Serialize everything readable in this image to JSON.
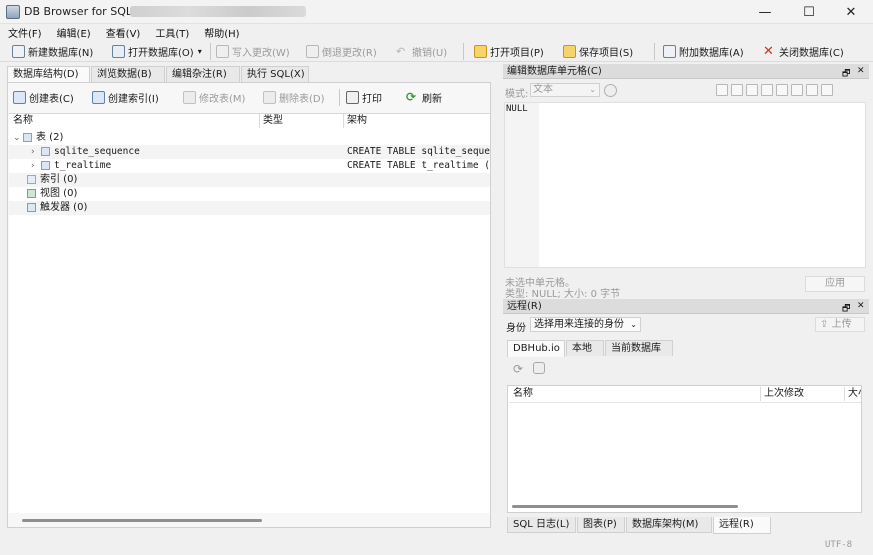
{
  "window": {
    "title": "DB Browser for SQLite - ",
    "controls": {
      "minimize": "—",
      "maximize": "☐",
      "close": "✕"
    }
  },
  "menubar": [
    "文件(F)",
    "编辑(E)",
    "查看(V)",
    "工具(T)",
    "帮助(H)"
  ],
  "toolbar": {
    "new_db": "新建数据库(N)",
    "open_db": "打开数据库(O)",
    "write_changes": "写入更改(W)",
    "revert_changes": "倒退更改(R)",
    "undo": "撤销(U)",
    "open_project": "打开项目(P)",
    "save_project": "保存项目(S)",
    "attach_db": "附加数据库(A)",
    "close_db": "关闭数据库(C)"
  },
  "left_tabs": [
    "数据库结构(D)",
    "浏览数据(B)",
    "编辑杂注(R)",
    "执行 SQL(X)"
  ],
  "structure_toolbar": {
    "create_table": "创建表(C)",
    "create_index": "创建索引(I)",
    "modify_table": "修改表(M)",
    "delete_table": "删除表(D)",
    "print": "打印",
    "refresh": "刷新"
  },
  "tree": {
    "headers": [
      "名称",
      "类型",
      "架构"
    ],
    "rows": [
      {
        "name": "表 (2)",
        "schema": ""
      },
      {
        "name": "sqlite_sequence",
        "schema": "CREATE TABLE sqlite_sequence"
      },
      {
        "name": "t_realtime",
        "schema": "CREATE TABLE t_realtime (ID"
      },
      {
        "name": "索引 (0)",
        "schema": ""
      },
      {
        "name": "视图 (0)",
        "schema": ""
      },
      {
        "name": "触发器 (0)",
        "schema": ""
      }
    ]
  },
  "edit_cell": {
    "title": "编辑数据库单元格(C)",
    "mode_label": "模式:",
    "mode_value": "文本",
    "content": "NULL",
    "info_line1": "未选中单元格。",
    "info_line2": "类型: NULL; 大小: 0 字节",
    "apply": "应用"
  },
  "remote": {
    "title": "远程(R)",
    "identity_label": "身份",
    "identity_value": "选择用来连接的身份",
    "upload": "上传",
    "tabs": [
      "DBHub.io",
      "本地",
      "当前数据库"
    ],
    "columns": [
      "名称",
      "上次修改",
      "大小"
    ]
  },
  "bottom_tabs": [
    "SQL 日志(L)",
    "图表(P)",
    "数据库架构(M)",
    "远程(R)"
  ],
  "status": {
    "encoding": "UTF-8"
  },
  "panel_float": "🗗",
  "panel_close": "✕",
  "colors": {
    "accent": "#3f7fc6",
    "panel_header": "#dcdcdc"
  }
}
